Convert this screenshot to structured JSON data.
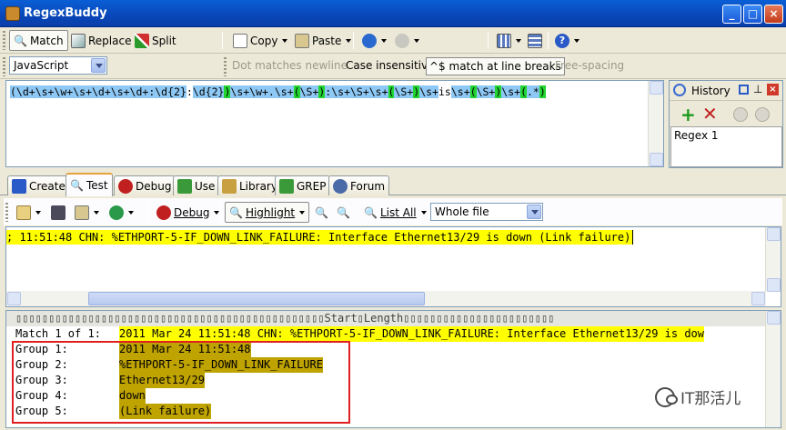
{
  "window": {
    "title": "RegexBuddy"
  },
  "toolbar1": {
    "match": "Match",
    "replace": "Replace",
    "split": "Split",
    "copy": "Copy",
    "paste": "Paste"
  },
  "toolbar2": {
    "flavor": "JavaScript",
    "dot_newline": "Dot matches newline",
    "case_insensitive": "Case insensitive",
    "line_breaks": "^$ match at line breaks",
    "free_spacing": "Free-spacing"
  },
  "regex": {
    "tokens": [
      {
        "t": "(\\d+\\s+\\w+\\s+\\d+\\s+\\d+:",
        "c": "blue"
      },
      {
        "t": "\\d{2}",
        "c": "blue"
      },
      {
        "t": ":",
        "c": "plain"
      },
      {
        "t": "\\d",
        "c": "blue"
      },
      {
        "t": "{2}",
        "c": "blue"
      },
      {
        "t": ")",
        "c": "green"
      },
      {
        "t": "\\s+\\w+.\\s+",
        "c": "blue"
      },
      {
        "t": "(",
        "c": "green"
      },
      {
        "t": "\\S+",
        "c": "blue"
      },
      {
        "t": ")",
        "c": "green"
      },
      {
        "t": ":\\s+\\S+\\s+",
        "c": "blue"
      },
      {
        "t": "(",
        "c": "green"
      },
      {
        "t": "\\S+",
        "c": "blue"
      },
      {
        "t": ")",
        "c": "green"
      },
      {
        "t": "\\s+",
        "c": "blue"
      },
      {
        "t": "is",
        "c": "plain"
      },
      {
        "t": "\\s+",
        "c": "blue"
      },
      {
        "t": "(",
        "c": "green"
      },
      {
        "t": "\\S+",
        "c": "blue"
      },
      {
        "t": ")",
        "c": "green"
      },
      {
        "t": "\\s+",
        "c": "blue"
      },
      {
        "t": "(",
        "c": "green"
      },
      {
        "t": ".*",
        "c": "blue"
      },
      {
        "t": ")",
        "c": "green"
      }
    ]
  },
  "history": {
    "title": "History",
    "items": [
      "Regex 1"
    ]
  },
  "tabs": [
    "Create",
    "Test",
    "Debug",
    "Use",
    "Library",
    "GREP",
    "Forum"
  ],
  "testbar": {
    "debug": "Debug",
    "highlight": "Highlight",
    "list_all": "List All",
    "scope": "Whole file"
  },
  "subject": {
    "text": "; 11:51:48 CHN: %ETHPORT-5-IF_DOWN_LINK_FAILURE: Interface Ethernet13/29 is down (Link failure)"
  },
  "results": {
    "header": "\u0000\u0000\u0000\u0000\u0000\u0000\u0000\u0000\u0000\u0000\u0000\u0000\u0000\u0000\u0000\u0000\u0000\u0000\u0000\u0000\u0000\u0000\u0000\u0000\u0000\u0000\u0000\u0000\u0000\u0000\u0000\u0000\u0000\u0000\u0000\u0000\u0000\u0000\u0000\u0000\u0000\u0000\u0000\u0000\u0000\u0000\u0000Start\u0000Length\u0000\u0000\u0000\u0000\u0000\u0000\u0000\u0000\u0000\u0000\u0000\u0000\u0000\u0000\u0000\u0000\u0000\u0000\u0000\u0000\u0000\u0000\u0000",
    "match_label": "Match 1 of 1:",
    "match_value": "2011 Mar 24 11:51:48 CHN: %ETHPORT-5-IF_DOWN_LINK_FAILURE: Interface Ethernet13/29 is dow",
    "groups": [
      {
        "label": "Group 1:",
        "value": "2011 Mar 24 11:51:48"
      },
      {
        "label": "Group 2:",
        "value": "%ETHPORT-5-IF_DOWN_LINK_FAILURE"
      },
      {
        "label": "Group 3:",
        "value": "Ethernet13/29"
      },
      {
        "label": "Group 4:",
        "value": "down"
      },
      {
        "label": "Group 5:",
        "value": "(Link failure)"
      }
    ]
  },
  "watermark": {
    "text": "IT那活儿"
  },
  "colors": {
    "regex_blue": "#8ec8f4",
    "regex_green": "#22d430",
    "match_yellow": "#ffff00",
    "group_gold": "#bfa300",
    "red_box": "#e02020"
  }
}
